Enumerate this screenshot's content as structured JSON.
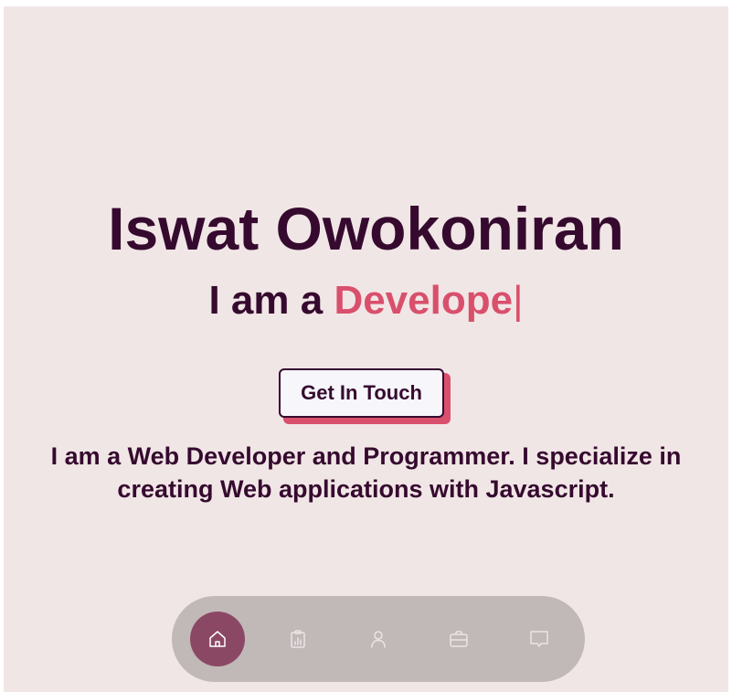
{
  "hero": {
    "name": "Iswat Owokoniran",
    "role_prefix": "I am a ",
    "role_typed": "Develope",
    "caret": "|",
    "cta_label": "Get In Touch",
    "bio": "I am a Web Developer and Programmer. I specialize in creating Web applications with Javascript."
  },
  "nav": {
    "items": [
      {
        "icon": "home-icon",
        "active": true
      },
      {
        "icon": "clipboard-chart-icon",
        "active": false
      },
      {
        "icon": "user-icon",
        "active": false
      },
      {
        "icon": "briefcase-icon",
        "active": false
      },
      {
        "icon": "chat-icon",
        "active": false
      }
    ]
  },
  "colors": {
    "background": "#f1e6e6",
    "text": "#360a2f",
    "accent": "#d9506c",
    "nav_bar": "#c1b8b8",
    "nav_active": "#8b4865"
  }
}
